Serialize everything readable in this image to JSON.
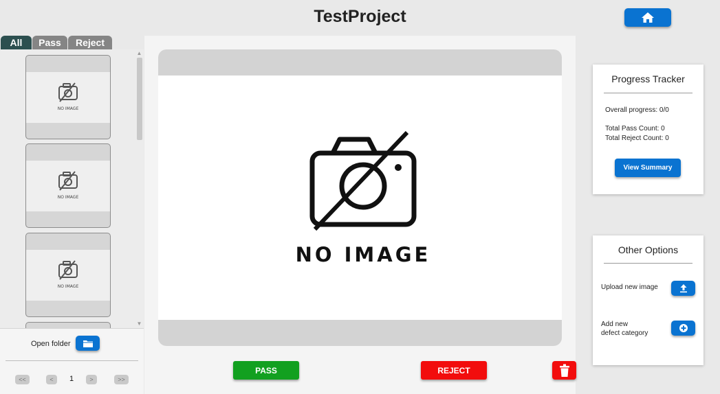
{
  "header": {
    "title": "TestProject",
    "home_icon": "home-icon"
  },
  "filter_tabs": [
    {
      "label": "All",
      "active": true
    },
    {
      "label": "Pass",
      "active": false
    },
    {
      "label": "Reject",
      "active": false
    }
  ],
  "thumbnails": [
    {
      "placeholder_text": "NO IMAGE"
    },
    {
      "placeholder_text": "NO IMAGE"
    },
    {
      "placeholder_text": "NO IMAGE"
    }
  ],
  "folder": {
    "label": "Open folder",
    "icon": "folder-icon"
  },
  "pagination": {
    "first_label": "<<",
    "prev_label": "<",
    "current_page": "1",
    "next_label": ">",
    "last_label": ">>"
  },
  "viewer": {
    "placeholder_text": "NO IMAGE"
  },
  "actions": {
    "pass_label": "PASS",
    "reject_label": "REJECT",
    "delete_icon": "trash-icon"
  },
  "progress": {
    "title": "Progress Tracker",
    "overall": "Overall progress: 0/0",
    "pass_count": "Total Pass Count: 0",
    "reject_count": "Total Reject Count: 0",
    "summary_button": "View Summary"
  },
  "options": {
    "title": "Other Options",
    "upload_label": "Upload new image",
    "upload_icon": "upload-icon",
    "add_category_line1": "Add new",
    "add_category_line2": "defect category",
    "add_icon": "plus-circle-icon"
  },
  "colors": {
    "primary_blue": "#0a73d1",
    "pass_green": "#12a020",
    "reject_red": "#f20d0d",
    "active_tab": "#2c4f4f",
    "inactive_tab": "#858585"
  }
}
